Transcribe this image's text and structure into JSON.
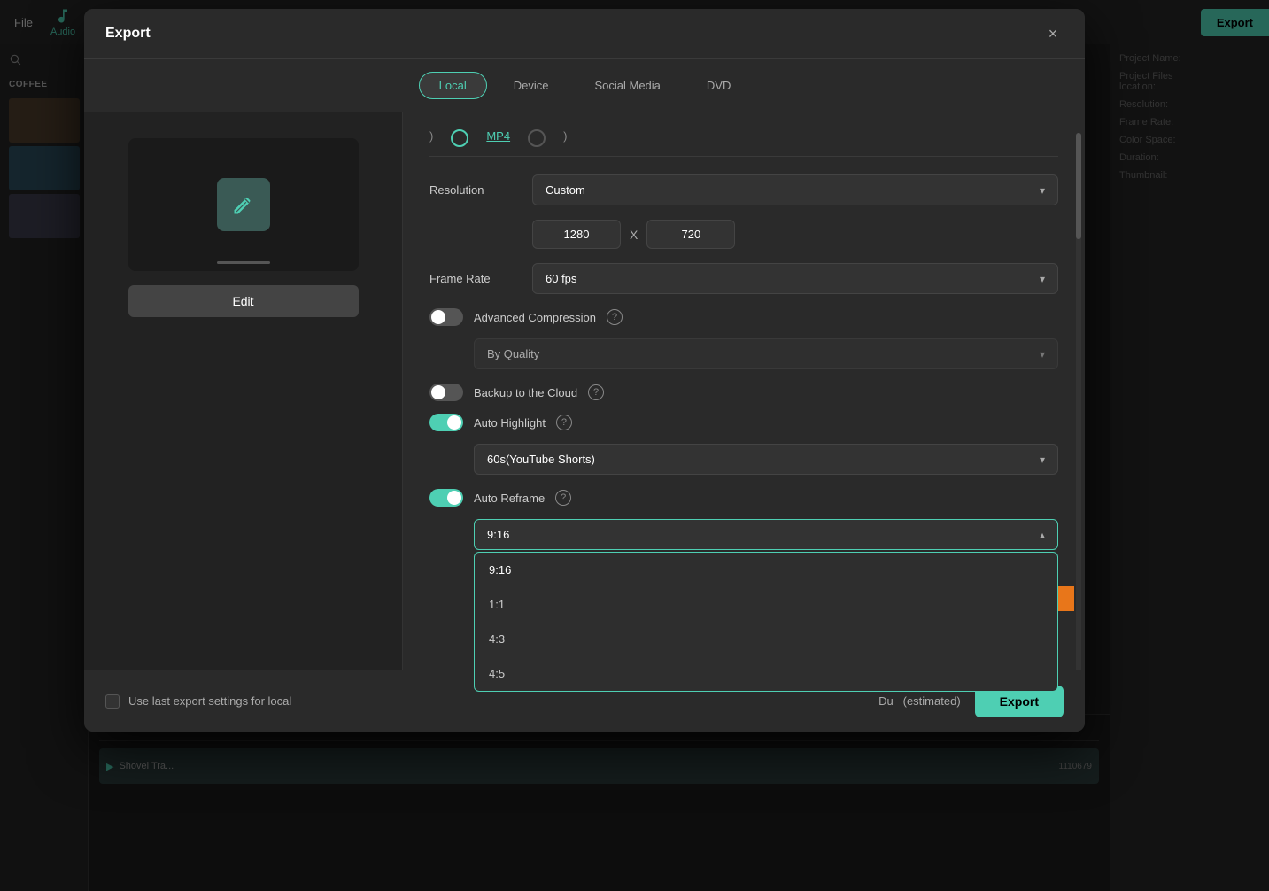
{
  "app": {
    "file_menu": "File",
    "audio_label": "Audio",
    "export_btn_top": "Export"
  },
  "modal": {
    "title": "Export",
    "close_label": "×",
    "tabs": [
      {
        "id": "local",
        "label": "Local",
        "active": true
      },
      {
        "id": "device",
        "label": "Device",
        "active": false
      },
      {
        "id": "social",
        "label": "Social Media",
        "active": false
      },
      {
        "id": "dvd",
        "label": "DVD",
        "active": false
      }
    ],
    "preview": {
      "edit_btn": "Edit"
    },
    "settings": {
      "resolution_label": "Resolution",
      "resolution_value": "Custom",
      "width": "1280",
      "x_separator": "X",
      "height": "720",
      "frame_rate_label": "Frame Rate",
      "frame_rate_value": "60 fps",
      "advanced_compression": {
        "label": "Advanced Compression",
        "state": "off"
      },
      "by_quality_value": "By Quality",
      "backup_cloud": {
        "label": "Backup to the Cloud",
        "state": "off"
      },
      "auto_highlight": {
        "label": "Auto Highlight",
        "state": "on"
      },
      "highlight_duration": "60s(YouTube Shorts)",
      "auto_reframe": {
        "label": "Auto Reframe",
        "state": "on"
      },
      "reframe_ratio": "9:16",
      "reframe_options": [
        {
          "value": "9:16",
          "selected": true
        },
        {
          "value": "1:1",
          "selected": false
        },
        {
          "value": "4:3",
          "selected": false
        },
        {
          "value": "4:5",
          "selected": false
        }
      ]
    },
    "footer": {
      "use_last_label": "Use last export settings for local",
      "duration_label": "Du",
      "estimated_label": "(estimated)",
      "export_btn": "Export"
    }
  },
  "right_panel": {
    "project_name_label": "Project Name:",
    "project_files_label": "Project Files",
    "location_label": "location:",
    "resolution_label": "Resolution:",
    "frame_rate_label": "Frame Rate:",
    "color_space_label": "Color Space:",
    "duration_label": "Duration:",
    "thumbnail_label": "Thumbnail:"
  }
}
